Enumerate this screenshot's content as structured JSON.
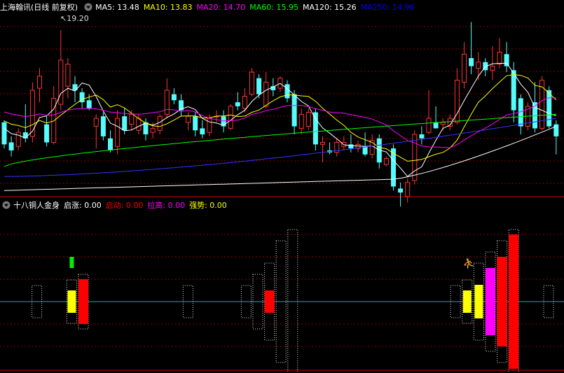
{
  "main_panel": {
    "title": "上海翰讯(日线 前复权)",
    "ma_labels": [
      {
        "text": "MA5: 13.48",
        "color": "#ffffff"
      },
      {
        "text": "MA10: 13.83",
        "color": "#ffff00"
      },
      {
        "text": "MA20: 14.70",
        "color": "#ff00ff"
      },
      {
        "text": "MA60: 15.95",
        "color": "#00ff00"
      },
      {
        "text": "MA120: 15.26",
        "color": "#ffffff"
      },
      {
        "text": "MA250: 14.96",
        "color": "#0000ff"
      }
    ],
    "high_marker": "19.20"
  },
  "indicator_panel": {
    "title": "十八铜人金身",
    "values": [
      {
        "text": "启涨: 0.00",
        "color": "#ffffff"
      },
      {
        "text": "启动: 0.00",
        "color": "#ff0000"
      },
      {
        "text": "拉高: 0.00",
        "color": "#ff00ff"
      },
      {
        "text": "强势: 0.00",
        "color": "#ffff00"
      }
    ]
  },
  "colors": {
    "up": "#ff3232",
    "down": "#54fcfc",
    "grid": "#8b0000",
    "divider": "#cc0000"
  },
  "price_range": [
    11.0,
    20.0
  ],
  "candles": [
    [
      14.6,
      13.5,
      14.7,
      13.3
    ],
    [
      13.6,
      13.2,
      13.9,
      12.9
    ],
    [
      13.4,
      14.1,
      14.3,
      13.2
    ],
    [
      14.1,
      13.8,
      15.5,
      13.6
    ],
    [
      13.9,
      16.2,
      16.6,
      13.6
    ],
    [
      16.3,
      16.9,
      17.3,
      15.6
    ],
    [
      14.5,
      13.6,
      14.9,
      13.4
    ],
    [
      13.6,
      15.8,
      16.4,
      13.5
    ],
    [
      15.5,
      17.7,
      19.2,
      15.2
    ],
    [
      16.4,
      17.5,
      17.8,
      15.8
    ],
    [
      16.5,
      16.2,
      16.9,
      15.6
    ],
    [
      16.1,
      15.6,
      16.3,
      15.3
    ],
    [
      15.7,
      15.3,
      16.0,
      15.2
    ],
    [
      14.4,
      14.8,
      15.0,
      13.3
    ],
    [
      14.9,
      13.9,
      15.1,
      13.7
    ],
    [
      13.8,
      13.2,
      14.2,
      13.1
    ],
    [
      13.4,
      14.8,
      15.2,
      13.0
    ],
    [
      14.9,
      14.2,
      15.3,
      14.0
    ],
    [
      14.5,
      15.0,
      15.2,
      14.2
    ],
    [
      14.2,
      14.8,
      15.0,
      14.0
    ],
    [
      14.6,
      14.0,
      14.8,
      13.7
    ],
    [
      14.1,
      14.3,
      14.6,
      13.8
    ],
    [
      14.2,
      14.9,
      15.0,
      14.0
    ],
    [
      15.0,
      16.2,
      16.8,
      14.8
    ],
    [
      16.0,
      15.7,
      16.3,
      15.5
    ],
    [
      15.7,
      15.2,
      16.0,
      14.9
    ],
    [
      14.6,
      14.9,
      15.1,
      14.2
    ],
    [
      14.9,
      14.2,
      15.1,
      13.9
    ],
    [
      14.3,
      14.0,
      14.7,
      13.8
    ],
    [
      14.1,
      14.8,
      15.0,
      13.9
    ],
    [
      14.9,
      14.9,
      15.2,
      14.6
    ],
    [
      14.9,
      14.4,
      15.2,
      14.1
    ],
    [
      14.3,
      15.4,
      15.5,
      14.2
    ],
    [
      15.6,
      15.4,
      16.1,
      15.2
    ],
    [
      15.3,
      15.9,
      16.3,
      15.1
    ],
    [
      16.0,
      17.1,
      17.3,
      15.9
    ],
    [
      16.8,
      16.0,
      17.0,
      15.8
    ],
    [
      15.4,
      16.6,
      17.1,
      15.3
    ],
    [
      16.4,
      16.2,
      16.8,
      15.9
    ],
    [
      16.3,
      16.8,
      16.9,
      16.1
    ],
    [
      16.5,
      15.8,
      16.7,
      15.6
    ],
    [
      16.0,
      14.4,
      16.2,
      14.0
    ],
    [
      14.3,
      15.0,
      15.3,
      14.0
    ],
    [
      14.4,
      15.1,
      15.3,
      14.2
    ],
    [
      15.1,
      13.5,
      15.3,
      13.2
    ],
    [
      13.5,
      13.6,
      13.9,
      12.6
    ],
    [
      13.2,
      13.1,
      13.6,
      13.0
    ],
    [
      13.1,
      13.6,
      13.8,
      12.9
    ],
    [
      13.4,
      13.6,
      13.9,
      13.2
    ],
    [
      13.5,
      13.3,
      14.0,
      13.1
    ],
    [
      13.3,
      13.5,
      13.7,
      13.1
    ],
    [
      13.4,
      13.0,
      14.1,
      12.9
    ],
    [
      13.0,
      13.7,
      14.0,
      12.8
    ],
    [
      13.8,
      12.6,
      14.0,
      12.3
    ],
    [
      12.5,
      12.8,
      12.9,
      12.4
    ],
    [
      13.3,
      11.4,
      13.5,
      11.2
    ],
    [
      11.3,
      11.1,
      11.6,
      10.4
    ],
    [
      10.9,
      11.6,
      11.8,
      10.6
    ],
    [
      11.7,
      14.0,
      14.2,
      11.5
    ],
    [
      14.0,
      13.8,
      14.4,
      13.5
    ],
    [
      14.1,
      14.8,
      16.2,
      14.0
    ],
    [
      14.6,
      14.3,
      15.4,
      14.3
    ],
    [
      14.5,
      14.6,
      14.8,
      14.2
    ],
    [
      14.4,
      14.8,
      15.0,
      14.2
    ],
    [
      14.6,
      16.7,
      17.3,
      14.5
    ],
    [
      16.6,
      18.0,
      18.6,
      16.3
    ],
    [
      17.8,
      17.4,
      19.6,
      17.0
    ],
    [
      17.3,
      17.6,
      18.1,
      16.7
    ],
    [
      17.6,
      17.2,
      17.8,
      16.9
    ],
    [
      17.2,
      17.4,
      18.4,
      16.7
    ],
    [
      17.5,
      18.1,
      18.8,
      17.3
    ],
    [
      18.0,
      17.4,
      18.6,
      17.1
    ],
    [
      17.2,
      15.2,
      17.6,
      14.6
    ],
    [
      15.8,
      14.4,
      16.0,
      14.0
    ],
    [
      14.4,
      15.4,
      15.6,
      14.2
    ],
    [
      15.6,
      14.3,
      16.6,
      14.1
    ],
    [
      14.3,
      16.7,
      16.9,
      14.2
    ],
    [
      16.2,
      14.4,
      16.4,
      14.3
    ],
    [
      14.5,
      13.9,
      14.7,
      13.0
    ]
  ],
  "indicator_bars": [
    {
      "col": 1,
      "frame": 1,
      "yellow": 0,
      "red": 0,
      "magenta": 0
    },
    {
      "col": 4,
      "frame": 2,
      "yellow": 1,
      "red": 0,
      "magenta": 0
    },
    {
      "col": 5,
      "frame": 3,
      "yellow": 0,
      "red": 3,
      "magenta": 0
    },
    {
      "col": 14,
      "frame": 1,
      "yellow": 0,
      "red": 0,
      "magenta": 0
    },
    {
      "col": 19,
      "frame": 1,
      "yellow": 0,
      "red": 0,
      "magenta": 0
    },
    {
      "col": 20,
      "frame": 3,
      "yellow": 0,
      "red": 0,
      "magenta": 0
    },
    {
      "col": 21,
      "frame": 5,
      "yellow": 0,
      "red": 1,
      "magenta": 0
    },
    {
      "col": 22,
      "frame": 9,
      "yellow": 0,
      "red": 0,
      "magenta": 0
    },
    {
      "col": 23,
      "frame": 11,
      "yellow": 0,
      "red": 0,
      "magenta": 0
    },
    {
      "col": 37,
      "frame": 1,
      "yellow": 0,
      "red": 0,
      "magenta": 0
    },
    {
      "col": 38,
      "frame": 2,
      "yellow": 1,
      "red": 0,
      "magenta": 0
    },
    {
      "col": 39,
      "frame": 5,
      "yellow": 2,
      "red": 0,
      "magenta": 0
    },
    {
      "col": 40,
      "frame": 7,
      "yellow": 0,
      "red": 0,
      "magenta": 5
    },
    {
      "col": 41,
      "frame": 9,
      "yellow": 0,
      "red": 7,
      "magenta": 0
    },
    {
      "col": 42,
      "frame": 11,
      "yellow": 0,
      "red": 11,
      "magenta": 0
    },
    {
      "col": 45,
      "frame": 1,
      "yellow": 0,
      "red": 0,
      "magenta": 0
    }
  ],
  "ind_green_marker_col": 4,
  "ind_run_marker_col": 38
}
